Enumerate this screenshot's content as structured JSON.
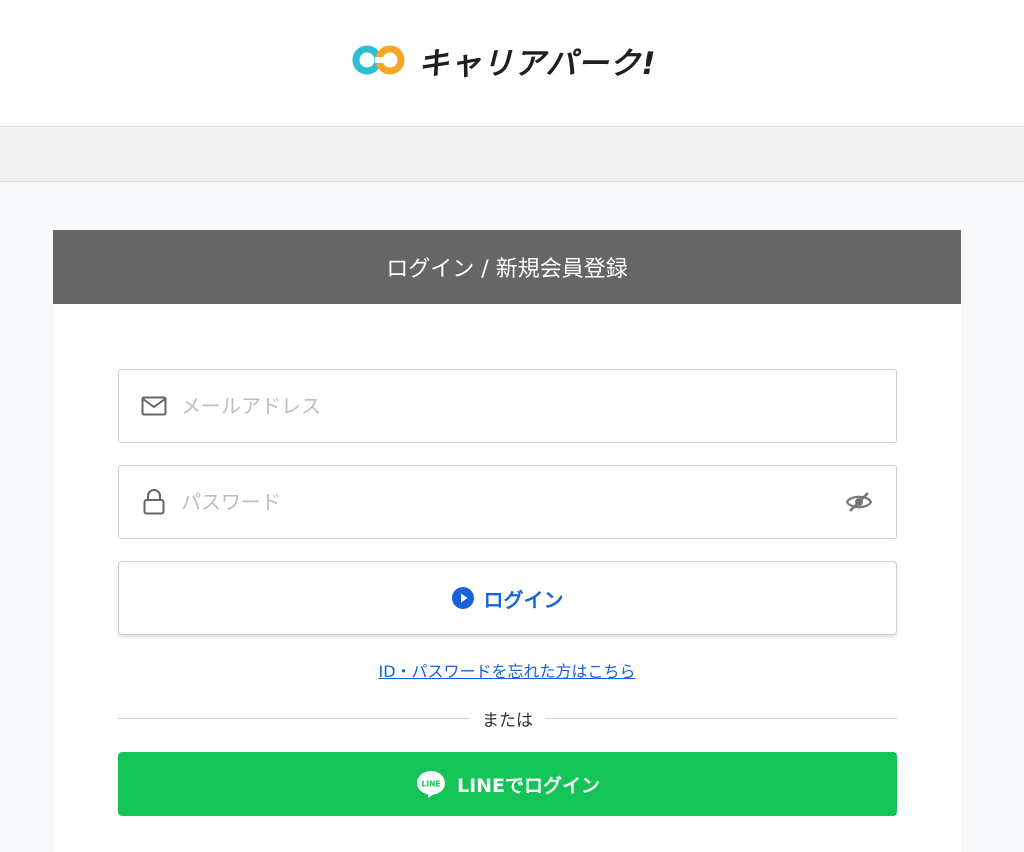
{
  "header": {
    "logo_text": "キャリアパーク!",
    "logo_icon": "co-logo-icon"
  },
  "card": {
    "title": "ログイン / 新規会員登録"
  },
  "form": {
    "email_placeholder": "メールアドレス",
    "email_value": "",
    "password_placeholder": "パスワード",
    "password_value": "",
    "login_label": "ログイン",
    "forgot_link": "ID・パスワードを忘れた方はこちら",
    "divider_text": "または",
    "line_login_label": "LINEでログイン",
    "line_icon_text": "LINE"
  },
  "colors": {
    "header_bar": "#666666",
    "link_blue": "#1563d6",
    "line_green": "#14c456",
    "logo_cyan": "#2bbfd6",
    "logo_orange": "#f5a623"
  }
}
